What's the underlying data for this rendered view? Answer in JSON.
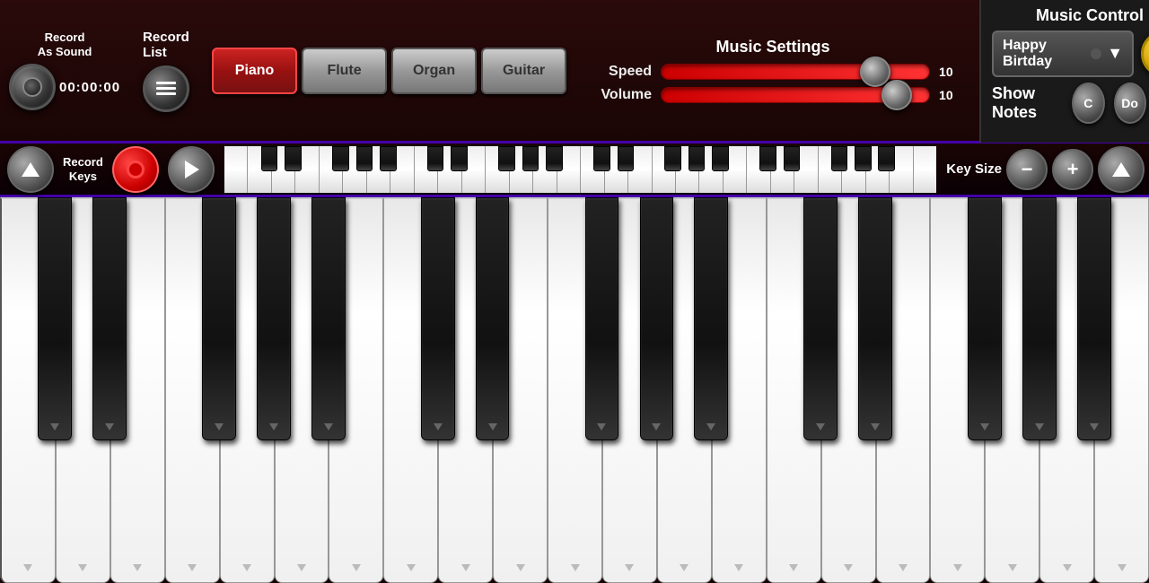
{
  "header": {
    "record_as_sound": "Record\nAs Sound",
    "record_as_sound_line1": "Record",
    "record_as_sound_line2": "As Sound",
    "timer": "00:00:00",
    "record_list": "Record List",
    "instruments": [
      "Piano",
      "Flute",
      "Organ",
      "Guitar"
    ],
    "active_instrument": "Piano",
    "music_settings_title": "Music Settings",
    "speed_label": "Speed",
    "volume_label": "Volume",
    "speed_value": "10",
    "volume_value": "10",
    "speed_percent": 80,
    "volume_percent": 88
  },
  "music_control": {
    "title": "Music Control",
    "song_name": "Happy Birtday",
    "show_notes_label": "Show Notes",
    "note_c": "C",
    "note_do": "Do",
    "play_button_label": "play"
  },
  "middle_bar": {
    "record_keys_label": "Record\nKeys",
    "key_size_label": "Key Size"
  },
  "piano": {
    "white_keys_count": 21,
    "black_key_positions": [
      6.5,
      10.0,
      17.5,
      21.0,
      24.5,
      31.5,
      35.0,
      41.0,
      44.5,
      51.5,
      55.0,
      62.0,
      65.5,
      72.5,
      76.0,
      79.5
    ]
  }
}
